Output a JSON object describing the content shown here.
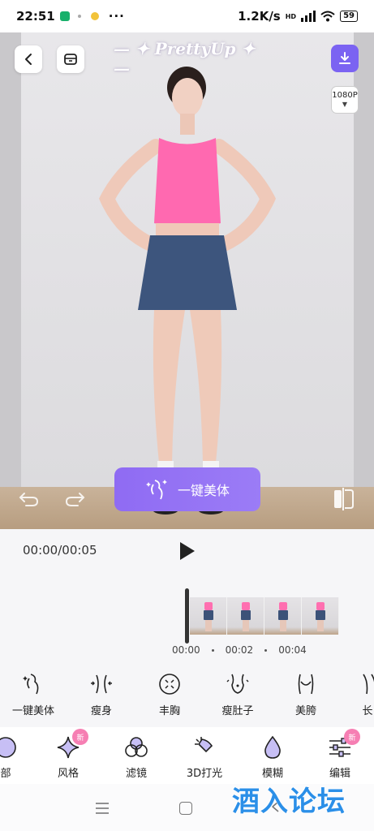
{
  "status_bar": {
    "time": "22:51",
    "more": "···",
    "network_speed": "1.2K/s",
    "hd": "HD",
    "battery": "59"
  },
  "header": {
    "brand": "— ✦ PrettyUp ✦ —",
    "resolution": "1080P",
    "resolution_arrow": "▼"
  },
  "editor": {
    "one_tap_beauty_button": "一键美体",
    "timecode": "00:00/00:05",
    "timeline_ticks": [
      "00:00",
      "00:02",
      "00:04"
    ]
  },
  "tools": [
    {
      "label": "一键美体",
      "icon": "body-magic-icon"
    },
    {
      "label": "瘦身",
      "icon": "slim-body-icon"
    },
    {
      "label": "丰胸",
      "icon": "bust-icon"
    },
    {
      "label": "瘦肚子",
      "icon": "slim-belly-icon"
    },
    {
      "label": "美胯",
      "icon": "hip-icon"
    },
    {
      "label": "长",
      "icon": "long-leg-icon"
    }
  ],
  "tabs": [
    {
      "label": "部",
      "icon": "partial-tab-icon",
      "badge": ""
    },
    {
      "label": "风格",
      "icon": "sparkle-star-icon",
      "badge": "新"
    },
    {
      "label": "滤镜",
      "icon": "filter-circles-icon",
      "badge": ""
    },
    {
      "label": "3D打光",
      "icon": "spotlight-icon",
      "badge": ""
    },
    {
      "label": "模糊",
      "icon": "blur-drop-icon",
      "badge": ""
    },
    {
      "label": "编辑",
      "icon": "adjust-sliders-icon",
      "badge": "新"
    }
  ],
  "watermark": "酒入论坛",
  "colors": {
    "accent": "#7b63f2",
    "badge": "#f67fb3",
    "watermark": "#2b8fe8"
  }
}
